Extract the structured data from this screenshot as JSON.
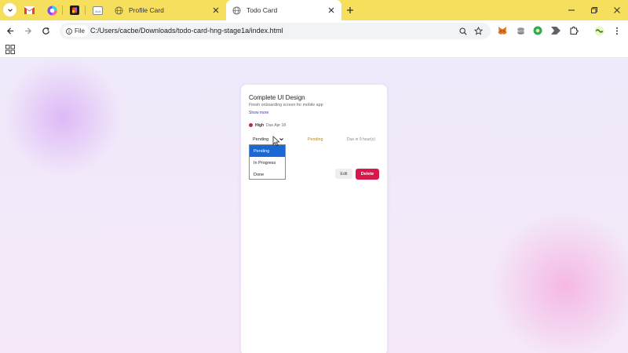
{
  "browser": {
    "tabs": [
      {
        "title": "Profile Card",
        "active": false
      },
      {
        "title": "Todo Card",
        "active": true
      }
    ],
    "address": {
      "chip_label": "File",
      "url": "C:/Users/cacbe/Downloads/todo-card-hng-stage1a/index.html"
    },
    "colors": {
      "tabstrip": "#f7df5e",
      "toolbar": "#ffffff"
    }
  },
  "card": {
    "title": "Complete UI Design",
    "description": "Finish onboarding screen for mobile app",
    "show_more": "Show more",
    "priority": "High",
    "due_date": "Due Apr 18",
    "status_select_value": "Pending",
    "status_text": "Pending",
    "due_relative": "Due in 9 hour(s)",
    "status_options": [
      "Pending",
      "In Progress",
      "Done"
    ],
    "selected_option": "Pending",
    "edit_label": "Edit",
    "delete_label": "Delete",
    "colors": {
      "priority_high": "#d11e48",
      "status_pending": "#b48a1a",
      "delete": "#d6184a",
      "option_highlight": "#1a68d6"
    }
  }
}
